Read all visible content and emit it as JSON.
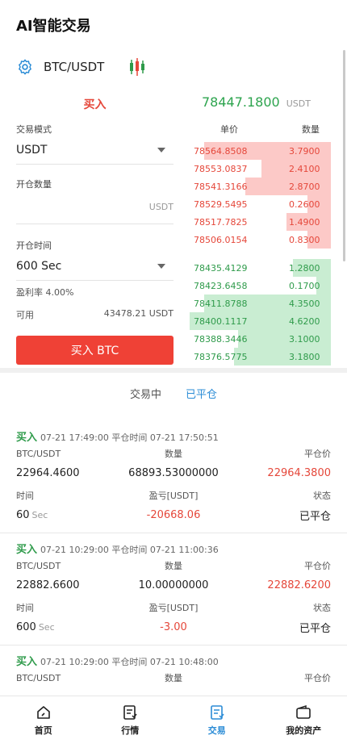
{
  "header": {
    "title": "AI智能交易"
  },
  "pair": {
    "name": "BTC/USDT"
  },
  "left": {
    "buy_label": "买入",
    "mode_label": "交易模式",
    "mode_value": "USDT",
    "qty_label": "开仓数量",
    "qty_unit": "USDT",
    "time_label": "开仓时间",
    "time_value": "600 Sec",
    "profit_rate": "盈利率 4.00%",
    "avail_label": "可用",
    "avail_value": "43478.21  USDT",
    "buy_button": "买入 BTC"
  },
  "price": {
    "current": "78447.1800",
    "unit": "USDT"
  },
  "orderbook": {
    "price_header": "单价",
    "qty_header": "数量",
    "asks": [
      {
        "price": "78564.8508",
        "qty": "3.7900",
        "depth": 0.86
      },
      {
        "price": "78553.0837",
        "qty": "2.4100",
        "depth": 0.47
      },
      {
        "price": "78541.3166",
        "qty": "2.8700",
        "depth": 0.58
      },
      {
        "price": "78529.5495",
        "qty": "0.2600",
        "depth": 0.16
      },
      {
        "price": "78517.7825",
        "qty": "1.4900",
        "depth": 0.3
      },
      {
        "price": "78506.0154",
        "qty": "0.8300",
        "depth": 0.16
      }
    ],
    "bids": [
      {
        "price": "78435.4129",
        "qty": "1.2800",
        "depth": 0.26
      },
      {
        "price": "78423.6458",
        "qty": "0.1700",
        "depth": 0.1
      },
      {
        "price": "78411.8788",
        "qty": "4.3500",
        "depth": 0.86
      },
      {
        "price": "78400.1117",
        "qty": "4.6200",
        "depth": 0.96
      },
      {
        "price": "78388.3446",
        "qty": "3.1000",
        "depth": 0.63
      },
      {
        "price": "78376.5775",
        "qty": "3.1800",
        "depth": 0.66
      }
    ]
  },
  "tabs": {
    "trading": "交易中",
    "closed": "已平仓"
  },
  "orders": [
    {
      "side": "买入",
      "header": "07-21 17:49:00 平仓时间 07-21 17:50:51",
      "pair_label": "BTC/USDT",
      "qty_label": "数量",
      "close_label": "平仓价",
      "open_price": "22964.4600",
      "qty": "68893.53000000",
      "close_price": "22964.3800",
      "time_label": "时间",
      "pnl_label": "盈亏[USDT]",
      "status_label": "状态",
      "duration": "60",
      "duration_unit": "Sec",
      "pnl": "-20668.06",
      "status": "已平仓"
    },
    {
      "side": "买入",
      "header": "07-21 10:29:00 平仓时间 07-21 11:00:36",
      "pair_label": "BTC/USDT",
      "qty_label": "数量",
      "close_label": "平仓价",
      "open_price": "22882.6600",
      "qty": "10.00000000",
      "close_price": "22882.6200",
      "time_label": "时间",
      "pnl_label": "盈亏[USDT]",
      "status_label": "状态",
      "duration": "600",
      "duration_unit": "Sec",
      "pnl": "-3.00",
      "status": "已平仓"
    },
    {
      "side": "买入",
      "header": "07-21 10:29:00 平仓时间 07-21 10:48:00",
      "pair_label": "BTC/USDT",
      "qty_label": "数量",
      "close_label": "平仓价",
      "open_price": "",
      "qty": "",
      "close_price": "",
      "time_label": "",
      "pnl_label": "",
      "status_label": "",
      "duration": "",
      "duration_unit": "",
      "pnl": "",
      "status": ""
    }
  ],
  "nav": [
    {
      "label": "首页",
      "icon": "home-icon"
    },
    {
      "label": "行情",
      "icon": "market-icon"
    },
    {
      "label": "交易",
      "icon": "trade-icon"
    },
    {
      "label": "我的资产",
      "icon": "wallet-icon"
    }
  ],
  "colors": {
    "accent": "#2b8cd6",
    "buy": "#ef4136",
    "up": "#2f9b4b"
  }
}
